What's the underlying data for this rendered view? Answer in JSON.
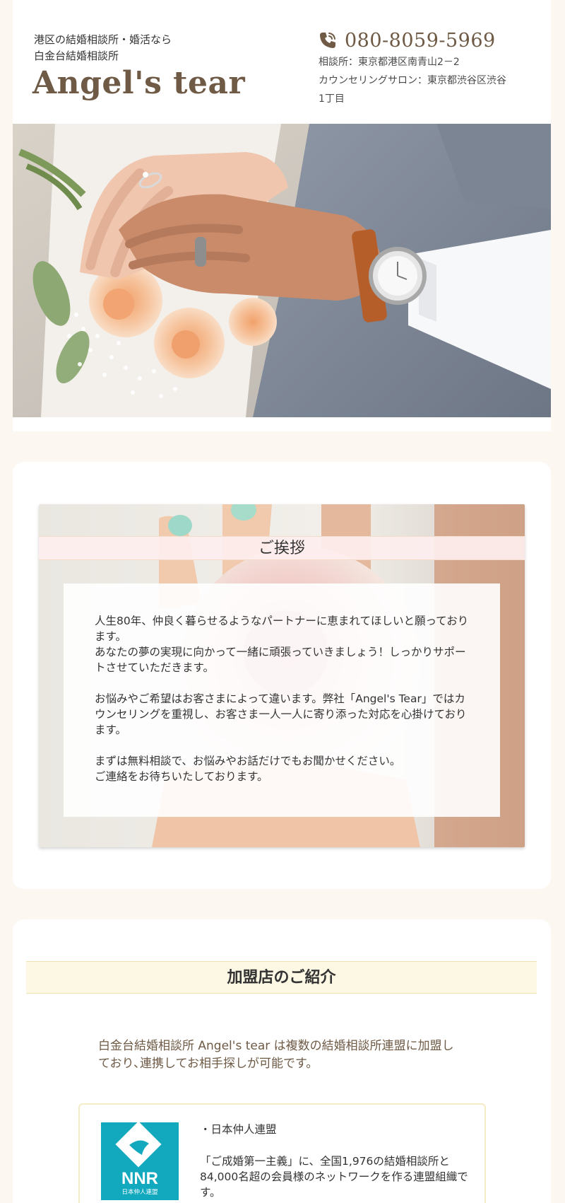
{
  "header": {
    "tagline_line1": "港区の結婚相談所・婚活なら",
    "tagline_line2": "白金台結婚相談所",
    "logo": "Angel's tear",
    "phone": "080-8059-5969",
    "address_line1": "相談所：東京都港区南青山2－2",
    "address_line2": "カウンセリングサロン：東京都渋谷区渋谷1丁目"
  },
  "greeting": {
    "title": "ご挨拶",
    "p1_l1": "人生80年、仲良く暮らせるようなパートナーに恵まれてほしいと願っております。",
    "p1_l2": "あなたの夢の実現に向かって一緒に頑張っていきましょう！しっかりサポートさせていただきます。",
    "p2": "お悩みやご希望はお客さまによって違います。弊社「Angel's Tear」ではカウンセリングを重視し、お客さま一人一人に寄り添った対応を心掛けております。",
    "p3_l1": "まずは無料相談で、お悩みやお話だけでもお聞かせください。",
    "p3_l2": "ご連絡をお待ちいたしております。"
  },
  "members": {
    "title": "加盟店のご紹介",
    "intro": "白金台結婚相談所 Angel's tear は複数の結婚相談所連盟に加盟しており､連携してお相手探しが可能です。",
    "items": [
      {
        "name": "・日本仲人連盟",
        "description": "「ご成婚第一主義」に、全国1,976の結婚相談所と84,000名超の会員様のネットワークを作る連盟組織です。",
        "logo_text": "NNR",
        "logo_subtext": "日本仲人連盟"
      }
    ]
  },
  "colors": {
    "page_bg": "#fdf7f2",
    "brand_brown": "#6e5a45",
    "greeting_band": "#fdeeee",
    "member_band": "#fdf8e4",
    "nnr_teal": "#12a9bf"
  }
}
